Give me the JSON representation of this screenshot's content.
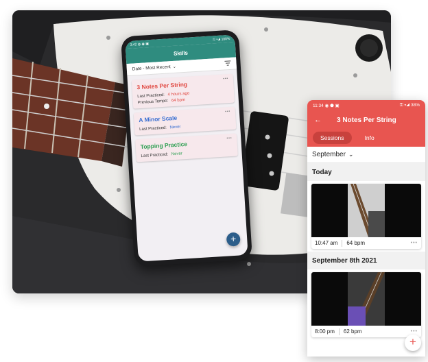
{
  "skills_phone": {
    "status_time": "3:42",
    "status_icons": "◍ ◉ ▣",
    "status_right": "⚿ ▾◢ 100%",
    "title": "Skills",
    "sort_label": "Date - Most Recent",
    "sort_chevron": "⌄",
    "filter_icon": "filter-icon",
    "cards": [
      {
        "title": "3 Notes Per String",
        "title_color": "#e0463f",
        "rows": [
          {
            "label": "Last Practiced:",
            "value": "4 hours ago"
          },
          {
            "label": "Previous Tempo:",
            "value": "64 bpm"
          }
        ],
        "value_color": "#e0463f"
      },
      {
        "title": "A Minor Scale",
        "title_color": "#3a6fd1",
        "rows": [
          {
            "label": "Last Practiced:",
            "value": "Never"
          }
        ],
        "value_color": "#3a6fd1"
      },
      {
        "title": "Topping Practice",
        "title_color": "#2e9f52",
        "rows": [
          {
            "label": "Last Practiced:",
            "value": "Never"
          }
        ],
        "value_color": "#2e9f52"
      }
    ],
    "card_more": "•••",
    "fab": "+",
    "accent": "#2f8c7f"
  },
  "detail_phone": {
    "status_time": "11:34",
    "status_icons": "◉ ⬟ ▣",
    "status_right": "⚿ ▾◢ 38%",
    "back_icon": "←",
    "title": "3 Notes Per String",
    "tabs": [
      {
        "label": "Sessions",
        "active": true
      },
      {
        "label": "Info",
        "active": false
      }
    ],
    "month": "September",
    "month_chevron": "⌄",
    "sections": [
      {
        "heading": "Today",
        "session": {
          "time": "10:47 am",
          "tempo": "64 bpm",
          "more": "•••"
        }
      },
      {
        "heading": "September 8th 2021",
        "session": {
          "time": "8:00 pm",
          "tempo": "62 bpm",
          "more": "•••"
        }
      }
    ],
    "fab": "+",
    "accent": "#e85550"
  }
}
